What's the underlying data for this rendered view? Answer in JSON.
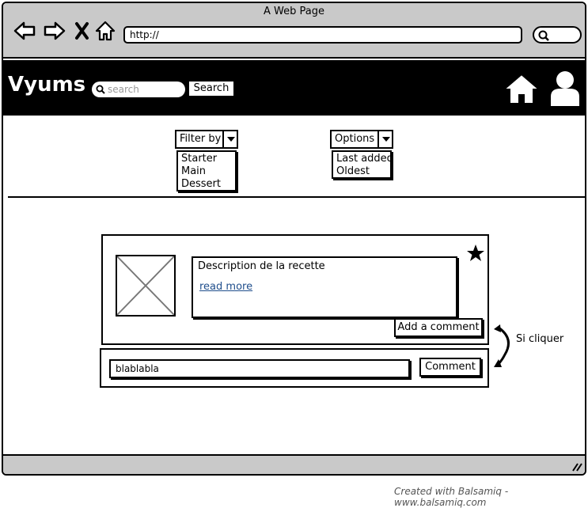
{
  "window": {
    "title": "A Web Page",
    "url": "http://"
  },
  "header": {
    "brand": "Vyums",
    "search_placeholder": "search",
    "search_button": "Search"
  },
  "filters": {
    "filter_by": {
      "label": "Filter by",
      "items": [
        "Starter",
        "Main",
        "Dessert"
      ]
    },
    "options": {
      "label": "Options",
      "items": [
        "Last added",
        "Oldest"
      ]
    }
  },
  "card": {
    "description": "Description de la recette",
    "read_more": "read more",
    "add_comment_button": "Add a comment"
  },
  "comment": {
    "input_value": "blablabla",
    "submit_button": "Comment"
  },
  "annotation": {
    "text": "Si cliquer"
  },
  "footer": {
    "credit": "Created with Balsamiq - www.balsamiq.com"
  },
  "icons": {
    "back": "arrow-left-icon",
    "forward": "arrow-right-icon",
    "stop": "close-icon",
    "home_nav": "home-icon",
    "search": "search-icon",
    "home": "home-icon",
    "user": "user-icon",
    "star": "star-icon",
    "image": "image-placeholder-icon"
  },
  "colors": {
    "header_bg": "#000000",
    "chrome_bg": "#c9c9c9",
    "link": "#1f4e8c"
  }
}
